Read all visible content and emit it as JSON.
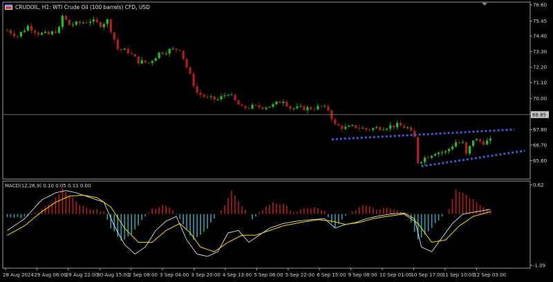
{
  "window": {
    "title": "CRUDOIL, H1:  WTI Crude Oil (100 barrels) CFD, USD",
    "price_box": "68.85"
  },
  "colors": {
    "background": "#000000",
    "bull": "#22c11e",
    "bear": "#b3201c",
    "frame": "#c8c8c8",
    "channel": "#3f5bd9",
    "macd_line": "#ffffff",
    "signal_line": "#ffe100",
    "hist_pos": "#b7201d",
    "hist_neg": "#3aa0b0"
  },
  "chart_data": [
    {
      "type": "candlestick",
      "title": "CRUDOIL, H1:  WTI Crude Oil (100 barrels) CFD, USD",
      "ylim": [
        64.3,
        76.8
      ],
      "yticks": [
        "76.60",
        "75.45",
        "74.40",
        "73.30",
        "72.20",
        "71.10",
        "70.00",
        "68.90",
        "67.80",
        "66.70",
        "65.60"
      ],
      "current_price": "68.85",
      "xticks": [
        "28 Aug 2024",
        "29 Aug 06:00",
        "29 Aug 22:00",
        "30 Aug 15:00",
        "2 Sep 08:00",
        "3 Sep 04:00",
        "3 Sep 20:00",
        "4 Sep 13:00",
        "5 Sep 06:00",
        "5 Sep 22:00",
        "6 Sep 15:00",
        "9 Sep 08:00",
        "10 Sep 01:00",
        "10 Sep 17:00",
        "11 Sep 10:00",
        "12 Sep 03:00"
      ],
      "anchors": [
        [
          0,
          74.8
        ],
        [
          3,
          74.4
        ],
        [
          6,
          75.1
        ],
        [
          9,
          74.6
        ],
        [
          12,
          74.5
        ],
        [
          15,
          74.9
        ],
        [
          16,
          75.8
        ],
        [
          18,
          75.2
        ],
        [
          21,
          75.3
        ],
        [
          24,
          75.5
        ],
        [
          27,
          75.2
        ],
        [
          29,
          75.5
        ],
        [
          32,
          73.5
        ],
        [
          35,
          73.3
        ],
        [
          38,
          72.6
        ],
        [
          41,
          72.5
        ],
        [
          44,
          73.2
        ],
        [
          47,
          73.4
        ],
        [
          50,
          73.5
        ],
        [
          52,
          72.2
        ],
        [
          55,
          70.4
        ],
        [
          58,
          70.0
        ],
        [
          61,
          69.9
        ],
        [
          64,
          70.4
        ],
        [
          66,
          69.8
        ],
        [
          68,
          69.3
        ],
        [
          71,
          69.4
        ],
        [
          74,
          69.4
        ],
        [
          77,
          69.5
        ],
        [
          80,
          69.9
        ],
        [
          82,
          69.3
        ],
        [
          85,
          69.3
        ],
        [
          88,
          69.3
        ],
        [
          91,
          69.4
        ],
        [
          93,
          69.2
        ],
        [
          95,
          68.1
        ],
        [
          98,
          67.9
        ],
        [
          101,
          68.0
        ],
        [
          104,
          67.8
        ],
        [
          107,
          67.9
        ],
        [
          110,
          68.0
        ],
        [
          113,
          68.1
        ],
        [
          116,
          67.9
        ],
        [
          118,
          67.2
        ],
        [
          119,
          65.5
        ],
        [
          121,
          65.8
        ],
        [
          124,
          66.2
        ],
        [
          127,
          66.2
        ],
        [
          130,
          66.9
        ],
        [
          132,
          66.8
        ],
        [
          133,
          66.0
        ],
        [
          135,
          67.1
        ],
        [
          138,
          66.9
        ],
        [
          140,
          67.0
        ]
      ],
      "candles_count": 141,
      "channel": {
        "upper": {
          "from": [
            94,
            67.1
          ],
          "to": [
            147,
            67.8
          ]
        },
        "lower": {
          "from": [
            120,
            65.2
          ],
          "to": [
            150,
            66.3
          ]
        }
      }
    },
    {
      "type": "macd",
      "label": "MACD(12,26,9) 0.10 0.05 0.11 0.00",
      "ylim": [
        -1.15,
        0.7
      ],
      "yticks": [
        "0.62",
        "-1.09"
      ],
      "hist_profile": [
        [
          0,
          -0.05
        ],
        [
          4,
          -0.1
        ],
        [
          9,
          0.05
        ],
        [
          13,
          0.25
        ],
        [
          16,
          0.55
        ],
        [
          19,
          0.35
        ],
        [
          22,
          0.15
        ],
        [
          25,
          0.1
        ],
        [
          28,
          0.05
        ],
        [
          30,
          -0.3
        ],
        [
          33,
          -0.55
        ],
        [
          36,
          -0.45
        ],
        [
          39,
          -0.1
        ],
        [
          42,
          0.1
        ],
        [
          45,
          0.2
        ],
        [
          48,
          0.1
        ],
        [
          51,
          -0.2
        ],
        [
          54,
          -0.55
        ],
        [
          57,
          -0.4
        ],
        [
          60,
          -0.1
        ],
        [
          63,
          0.2
        ],
        [
          65,
          0.5
        ],
        [
          68,
          0.15
        ],
        [
          71,
          -0.1
        ],
        [
          74,
          0.1
        ],
        [
          77,
          0.25
        ],
        [
          80,
          0.2
        ],
        [
          83,
          0.05
        ],
        [
          86,
          0.1
        ],
        [
          89,
          0.15
        ],
        [
          92,
          0.05
        ],
        [
          95,
          -0.3
        ],
        [
          98,
          -0.05
        ],
        [
          101,
          0.1
        ],
        [
          104,
          0.2
        ],
        [
          107,
          0.1
        ],
        [
          110,
          0.15
        ],
        [
          113,
          0.1
        ],
        [
          116,
          0.02
        ],
        [
          119,
          -0.55
        ],
        [
          122,
          -0.35
        ],
        [
          126,
          -0.05
        ],
        [
          128,
          0.1
        ],
        [
          130,
          0.5
        ],
        [
          132,
          0.45
        ],
        [
          135,
          0.3
        ],
        [
          138,
          0.15
        ],
        [
          140,
          0.1
        ]
      ],
      "macd_profile": [
        [
          0,
          -0.35
        ],
        [
          5,
          -0.1
        ],
        [
          10,
          0.3
        ],
        [
          14,
          0.45
        ],
        [
          17,
          0.5
        ],
        [
          20,
          0.45
        ],
        [
          24,
          0.35
        ],
        [
          28,
          0.25
        ],
        [
          31,
          -0.25
        ],
        [
          34,
          -0.65
        ],
        [
          37,
          -0.85
        ],
        [
          40,
          -0.7
        ],
        [
          43,
          -0.35
        ],
        [
          46,
          -0.15
        ],
        [
          49,
          -0.05
        ],
        [
          52,
          -0.55
        ],
        [
          55,
          -0.85
        ],
        [
          58,
          -0.9
        ],
        [
          61,
          -0.8
        ],
        [
          64,
          -0.4
        ],
        [
          67,
          -0.35
        ],
        [
          70,
          -0.6
        ],
        [
          73,
          -0.45
        ],
        [
          76,
          -0.3
        ],
        [
          80,
          -0.2
        ],
        [
          84,
          -0.15
        ],
        [
          88,
          -0.12
        ],
        [
          92,
          -0.1
        ],
        [
          95,
          -0.3
        ],
        [
          98,
          -0.22
        ],
        [
          101,
          -0.18
        ],
        [
          104,
          -0.1
        ],
        [
          107,
          -0.05
        ],
        [
          111,
          0.0
        ],
        [
          115,
          0.02
        ],
        [
          118,
          -0.1
        ],
        [
          120,
          -0.7
        ],
        [
          123,
          -0.8
        ],
        [
          126,
          -0.5
        ],
        [
          129,
          -0.2
        ],
        [
          132,
          0.0
        ],
        [
          136,
          0.05
        ],
        [
          140,
          0.1
        ]
      ],
      "signal_profile": [
        [
          0,
          -0.45
        ],
        [
          5,
          -0.25
        ],
        [
          10,
          0.05
        ],
        [
          14,
          0.25
        ],
        [
          18,
          0.38
        ],
        [
          22,
          0.4
        ],
        [
          26,
          0.35
        ],
        [
          30,
          0.15
        ],
        [
          34,
          -0.3
        ],
        [
          38,
          -0.6
        ],
        [
          42,
          -0.6
        ],
        [
          46,
          -0.35
        ],
        [
          50,
          -0.2
        ],
        [
          53,
          -0.4
        ],
        [
          56,
          -0.7
        ],
        [
          60,
          -0.8
        ],
        [
          64,
          -0.6
        ],
        [
          68,
          -0.45
        ],
        [
          72,
          -0.45
        ],
        [
          76,
          -0.35
        ],
        [
          80,
          -0.25
        ],
        [
          85,
          -0.18
        ],
        [
          90,
          -0.12
        ],
        [
          94,
          -0.15
        ],
        [
          98,
          -0.22
        ],
        [
          102,
          -0.18
        ],
        [
          106,
          -0.1
        ],
        [
          110,
          -0.05
        ],
        [
          115,
          0.0
        ],
        [
          119,
          -0.2
        ],
        [
          123,
          -0.6
        ],
        [
          127,
          -0.55
        ],
        [
          131,
          -0.25
        ],
        [
          135,
          -0.05
        ],
        [
          140,
          0.05
        ]
      ]
    }
  ]
}
